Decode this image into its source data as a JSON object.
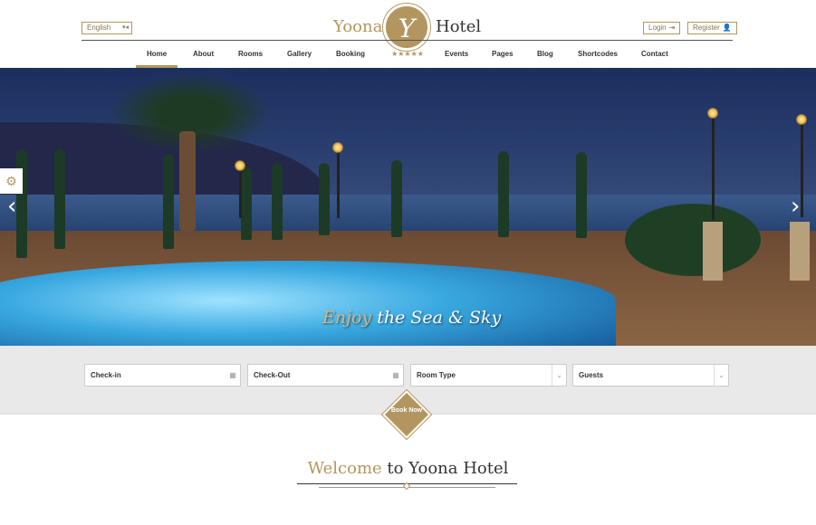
{
  "header": {
    "language": "English",
    "login": "Login",
    "register": "Register",
    "logo_left": "Yoona",
    "logo_letter": "Y",
    "logo_right": "Hotel",
    "stars": "★★★★★"
  },
  "nav": [
    "Home",
    "About",
    "Rooms",
    "Gallery",
    "Booking",
    "Events",
    "Pages",
    "Blog",
    "Shortcodes",
    "Contact"
  ],
  "hero": {
    "caption_1": "Enjoy",
    "caption_2": " the Sea & Sky"
  },
  "booking": {
    "checkin": "Check-in",
    "checkout": "Check-Out",
    "room_type": "Room Type",
    "guests": "Guests",
    "book_now": "Book Now"
  },
  "welcome": {
    "part1": "Welcome",
    "part2": " to Yoona Hotel"
  },
  "colors": {
    "accent": "#b3965f",
    "booking_bg": "#e9e9e9"
  }
}
